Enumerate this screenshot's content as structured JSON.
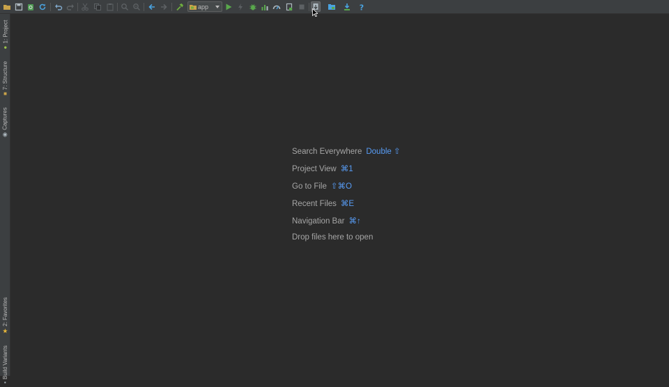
{
  "toolbar": {
    "run_config": "app",
    "buttons": [
      "open-icon",
      "save-icon",
      "sync-icon",
      "refresh-icon",
      "undo-icon",
      "redo-icon",
      "cut-icon",
      "copy-icon",
      "paste-icon",
      "find-icon",
      "replace-icon",
      "back-icon",
      "forward-icon",
      "build-icon",
      "run-icon",
      "apply-changes-icon",
      "debug-icon",
      "profile-icon",
      "attach-debugger-icon",
      "stop-icon",
      "sdk-manager-icon",
      "project-structure-icon",
      "avd-manager-icon",
      "help-icon"
    ]
  },
  "left_strip": {
    "tabs": [
      {
        "label": "1: Project",
        "icon": "android-icon"
      },
      {
        "label": "7: Structure",
        "icon": "structure-icon"
      },
      {
        "label": "Captures",
        "icon": "captures-icon"
      },
      {
        "label": "2: Favorites",
        "icon": "star-icon"
      },
      {
        "label": "Build Variants",
        "icon": "build-variants-icon"
      }
    ]
  },
  "editor": {
    "hints": [
      {
        "label": "Search Everywhere",
        "shortcut": "Double ⇧"
      },
      {
        "label": "Project View",
        "shortcut": "⌘1"
      },
      {
        "label": "Go to File",
        "shortcut": "⇧⌘O"
      },
      {
        "label": "Recent Files",
        "shortcut": "⌘E"
      },
      {
        "label": "Navigation Bar",
        "shortcut": "⌘↑"
      },
      {
        "label": "Drop files here to open",
        "shortcut": ""
      }
    ]
  },
  "colors": {
    "background": "#2b2b2b",
    "toolbar": "#3c3f41",
    "shortcut": "#589df6",
    "hint_text": "#a6a6a6"
  }
}
